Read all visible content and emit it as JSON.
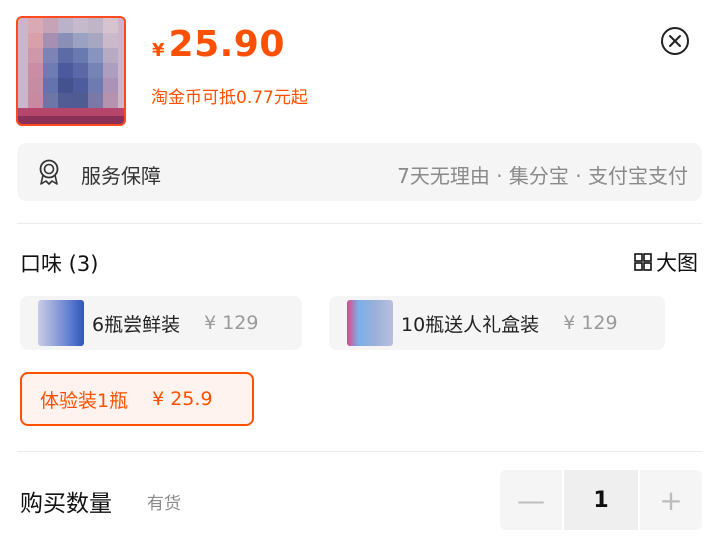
{
  "product": {
    "currency": "¥",
    "price": "25.90",
    "coin_offer": "淘金币可抵0.77元起"
  },
  "icons": {
    "close": "close-circle-icon",
    "service": "badge-icon",
    "big_pic": "grid-icon"
  },
  "service": {
    "label": "服务保障",
    "detail": "7天无理由 · 集分宝 · 支付宝支付"
  },
  "flavor": {
    "title": "口味 (3)",
    "big_pic_label": "大图",
    "options": [
      {
        "name": "6瓶尝鲜装",
        "price": "¥ 129",
        "selected": false
      },
      {
        "name": "10瓶送人礼盒装",
        "price": "¥ 129",
        "selected": false
      },
      {
        "name": "体验装1瓶",
        "price": "¥ 25.9",
        "selected": true
      }
    ]
  },
  "quantity": {
    "label": "购买数量",
    "stock": "有货",
    "value": "1",
    "minus": "—",
    "plus": "+"
  },
  "colors": {
    "accent": "#ff5000"
  }
}
